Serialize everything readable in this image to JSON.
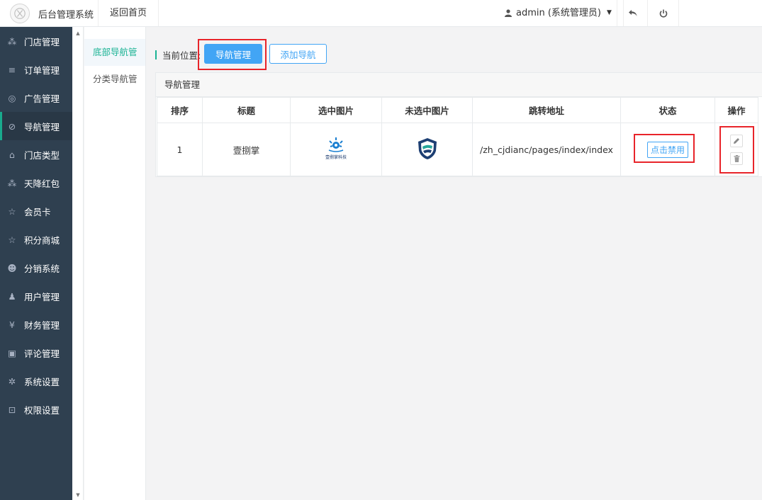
{
  "header": {
    "app_title": "后台管理系统",
    "back_home": "返回首页",
    "user_label": "admin (系统管理员)"
  },
  "sidebar": {
    "items": [
      {
        "label": "门店管理",
        "icon": "cubes-icon"
      },
      {
        "label": "订单管理",
        "icon": "list-icon"
      },
      {
        "label": "广告管理",
        "icon": "lifebuoy-icon"
      },
      {
        "label": "导航管理",
        "icon": "compass-icon",
        "active": true
      },
      {
        "label": "门店类型",
        "icon": "bank-icon"
      },
      {
        "label": "天降红包",
        "icon": "cubes-icon"
      },
      {
        "label": "会员卡",
        "icon": "star-icon"
      },
      {
        "label": "积分商城",
        "icon": "star-icon"
      },
      {
        "label": "分销系统",
        "icon": "users-icon"
      },
      {
        "label": "用户管理",
        "icon": "user-icon"
      },
      {
        "label": "财务管理",
        "icon": "yen-icon"
      },
      {
        "label": "评论管理",
        "icon": "money-icon"
      },
      {
        "label": "系统设置",
        "icon": "gear-icon"
      },
      {
        "label": "权限设置",
        "icon": "unlock-icon"
      }
    ]
  },
  "subnav": {
    "items": [
      {
        "label": "底部导航管",
        "active": true
      },
      {
        "label": "分类导航管"
      }
    ]
  },
  "toolbar": {
    "breadcrumb": "当前位置:",
    "primary_label": "导航管理",
    "add_label": "添加导航"
  },
  "panel": {
    "title": "导航管理",
    "columns": [
      "排序",
      "标题",
      "选中图片",
      "未选中图片",
      "跳转地址",
      "状态",
      "操作"
    ],
    "rows": [
      {
        "order": "1",
        "title": "壹捌掌",
        "selected_image": "壹捌掌科技",
        "unselected_image": "shield-logo",
        "url": "/zh_cjdianc/pages/index/index",
        "status_action": "点击禁用"
      }
    ]
  },
  "colors": {
    "sidebar_bg": "#2f4050",
    "accent": "#1ab394",
    "primary_button": "#42a5f5",
    "highlight": "#e8242a"
  }
}
